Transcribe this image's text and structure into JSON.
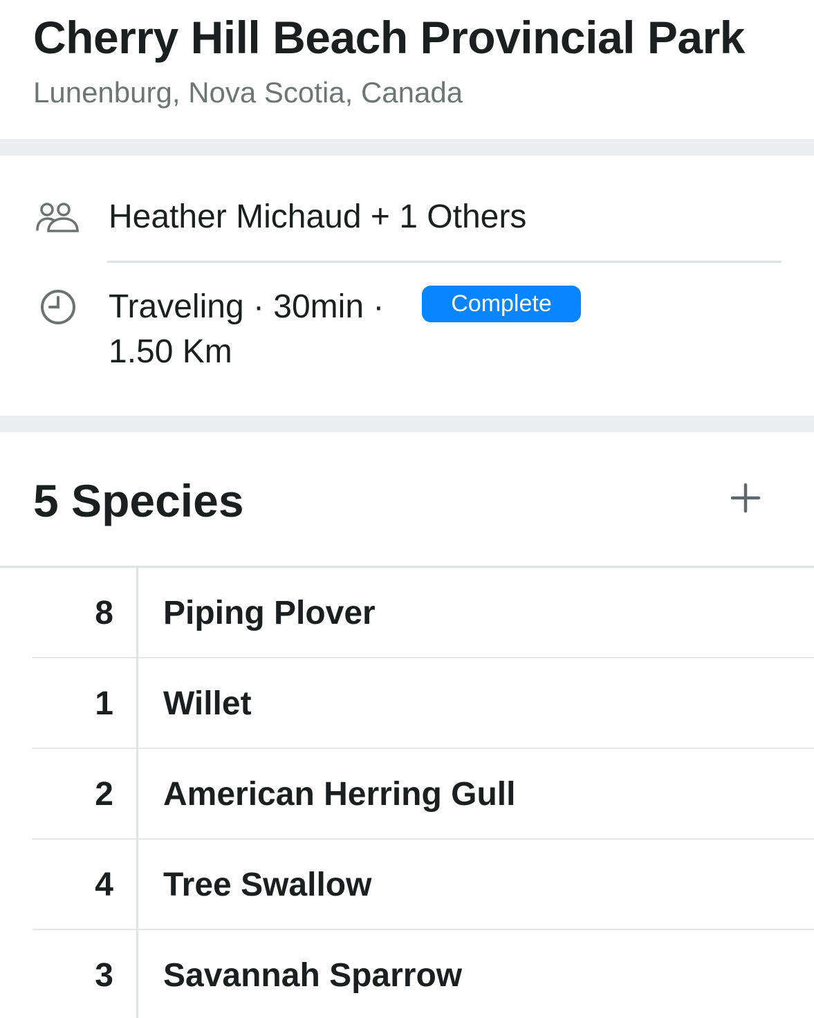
{
  "header": {
    "title": "Cherry Hill Beach Provincial Park",
    "location": "Lunenburg, Nova Scotia, Canada"
  },
  "details": {
    "observers": {
      "icon": "people-icon",
      "text": "Heather Michaud + 1 Others"
    },
    "protocol": {
      "icon": "clock-icon",
      "line1": "Traveling · 30min ·",
      "line2": "1.50 Km",
      "status_badge": "Complete",
      "badge_color": "#0a84ff"
    }
  },
  "species": {
    "heading": "5 Species",
    "add_icon": "plus-icon",
    "items": [
      {
        "count": "8",
        "name": "Piping Plover"
      },
      {
        "count": "1",
        "name": "Willet"
      },
      {
        "count": "2",
        "name": "American Herring Gull"
      },
      {
        "count": "4",
        "name": "Tree Swallow"
      },
      {
        "count": "3",
        "name": "Savannah Sparrow"
      }
    ]
  }
}
